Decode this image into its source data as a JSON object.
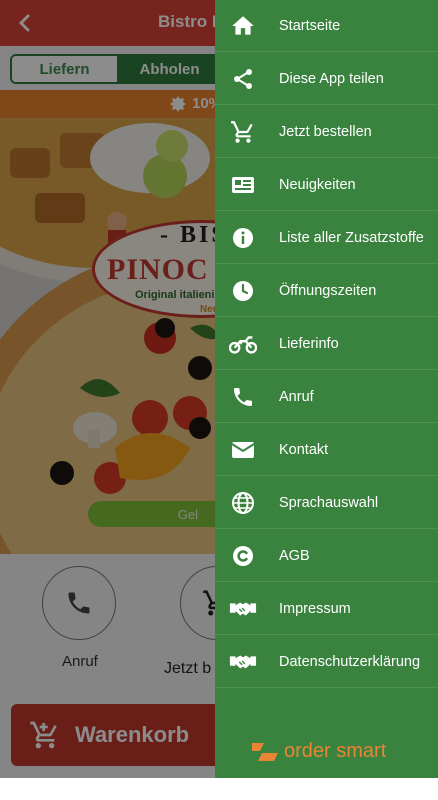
{
  "header": {
    "title": "Bistro P",
    "back_icon": "chevron-left-icon"
  },
  "order_mode": {
    "options": [
      {
        "label": "Liefern",
        "active": false
      },
      {
        "label": "Abholen",
        "active": true
      }
    ]
  },
  "promo": {
    "text": "10%"
  },
  "logo": {
    "line1": "- BIS",
    "name": "PINOC",
    "tagline": "Original italienisch-g",
    "subline": "Neue K"
  },
  "order_pill": {
    "label": "Gel"
  },
  "actions": [
    {
      "label": "Anruf",
      "icon": "phone-icon"
    },
    {
      "label": "Jetzt b",
      "icon": "cart-icon"
    }
  ],
  "cart": {
    "label": "Warenkorb",
    "icon": "cart-add-icon"
  },
  "drawer": {
    "items": [
      {
        "label": "Startseite",
        "icon": "home-icon"
      },
      {
        "label": "Diese App teilen",
        "icon": "share-icon"
      },
      {
        "label": "Jetzt bestellen",
        "icon": "cart-icon"
      },
      {
        "label": "Neuigkeiten",
        "icon": "news-icon"
      },
      {
        "label": "Liste aller Zusatzstoffe",
        "icon": "info-icon"
      },
      {
        "label": "Öffnungszeiten",
        "icon": "clock-icon"
      },
      {
        "label": "Lieferinfo",
        "icon": "motorcycle-icon"
      },
      {
        "label": "Anruf",
        "icon": "phone-icon"
      },
      {
        "label": "Kontakt",
        "icon": "envelope-icon"
      },
      {
        "label": "Sprachauswahl",
        "icon": "globe-icon"
      },
      {
        "label": "AGB",
        "icon": "copyright-icon"
      },
      {
        "label": "Impressum",
        "icon": "handshake-icon"
      },
      {
        "label": "Datenschutzerklärung",
        "icon": "handshake-icon"
      }
    ],
    "brand": "order smart"
  },
  "colors": {
    "drawer_bg": "#3a833f",
    "header_bg": "#d9433a",
    "promo_bg": "#e9842d",
    "brand": "#e88436",
    "cart_bg": "#c0392b"
  }
}
